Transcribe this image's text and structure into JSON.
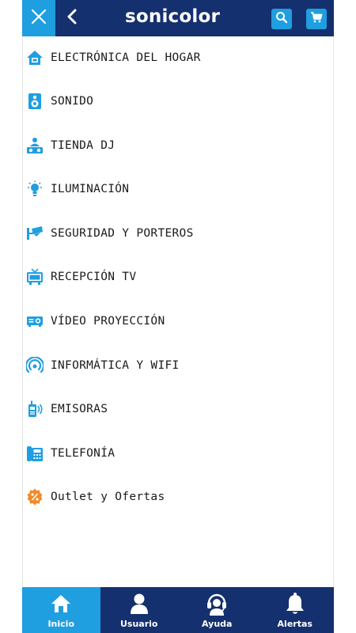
{
  "header": {
    "logo": "sonicolor",
    "close_icon": "close-icon",
    "back_icon": "chevron-left-icon",
    "search_icon": "search-icon",
    "cart_icon": "cart-icon"
  },
  "menu": {
    "items": [
      {
        "label": "ELECTRÓNICA DEL HOGAR",
        "icon": "home-electronics-icon"
      },
      {
        "label": "SONIDO",
        "icon": "speaker-icon"
      },
      {
        "label": "TIENDA DJ",
        "icon": "dj-icon"
      },
      {
        "label": "ILUMINACIÓN",
        "icon": "lightbulb-icon"
      },
      {
        "label": "SEGURIDAD Y PORTEROS",
        "icon": "security-camera-icon"
      },
      {
        "label": "RECEPCIÓN TV",
        "icon": "tv-icon"
      },
      {
        "label": "VÍDEO PROYECCIÓN",
        "icon": "projector-icon"
      },
      {
        "label": "INFORMÁTICA Y WIFI",
        "icon": "wifi-icon"
      },
      {
        "label": "EMISORAS",
        "icon": "walkie-talkie-icon"
      },
      {
        "label": "TELEFONÍA",
        "icon": "phone-icon"
      },
      {
        "label": "Outlet y Ofertas",
        "icon": "percent-badge-icon"
      }
    ]
  },
  "tabbar": {
    "tabs": [
      {
        "label": "Inicio",
        "icon": "home-icon",
        "active": true
      },
      {
        "label": "Usuario",
        "icon": "user-icon",
        "active": false
      },
      {
        "label": "Ayuda",
        "icon": "headset-icon",
        "active": false
      },
      {
        "label": "Alertas",
        "icon": "bell-icon",
        "active": false
      }
    ]
  },
  "colors": {
    "header_bg": "#15306e",
    "accent": "#1f9ee0",
    "menu_icon": "#1f9ee0",
    "outlet_icon": "#f08a2c",
    "text": "#1a1a1a"
  }
}
